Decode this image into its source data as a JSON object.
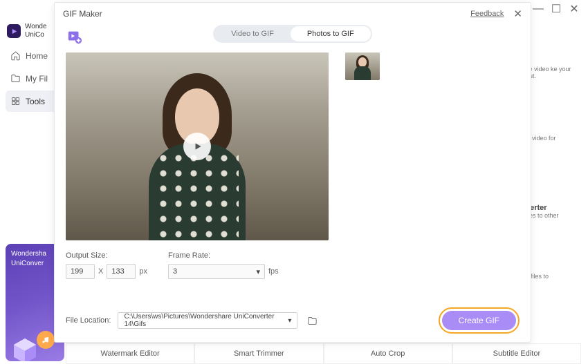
{
  "app": {
    "brand_line1": "Wonde",
    "brand_line2": "UniCo"
  },
  "sidebar": {
    "items": [
      {
        "label": "Home"
      },
      {
        "label": "My Fil"
      },
      {
        "label": "Tools"
      }
    ]
  },
  "promo": {
    "line1": "Wondersha",
    "line2": "UniConver"
  },
  "bg_tiles": [
    {
      "text": "se video ke your out."
    },
    {
      "text": "D video for"
    },
    {
      "title": "verter",
      "text": "ges to other"
    },
    {
      "text": "y files to"
    }
  ],
  "bottom_tools": [
    {
      "label": "Watermark Editor"
    },
    {
      "label": "Smart Trimmer"
    },
    {
      "label": "Auto Crop"
    },
    {
      "label": "Subtitle Editor"
    }
  ],
  "modal": {
    "title": "GIF Maker",
    "feedback": "Feedback",
    "tabs": [
      {
        "label": "Video to GIF",
        "active": false
      },
      {
        "label": "Photos to GIF",
        "active": true
      }
    ],
    "output_size": {
      "label": "Output Size:",
      "width": "199",
      "x": "X",
      "height": "133",
      "unit": "px"
    },
    "frame_rate": {
      "label": "Frame Rate:",
      "value": "3",
      "unit": "fps"
    },
    "file_location": {
      "label": "File Location:",
      "path": "C:\\Users\\ws\\Pictures\\Wondershare UniConverter 14\\Gifs"
    },
    "create_button": "Create GIF"
  }
}
